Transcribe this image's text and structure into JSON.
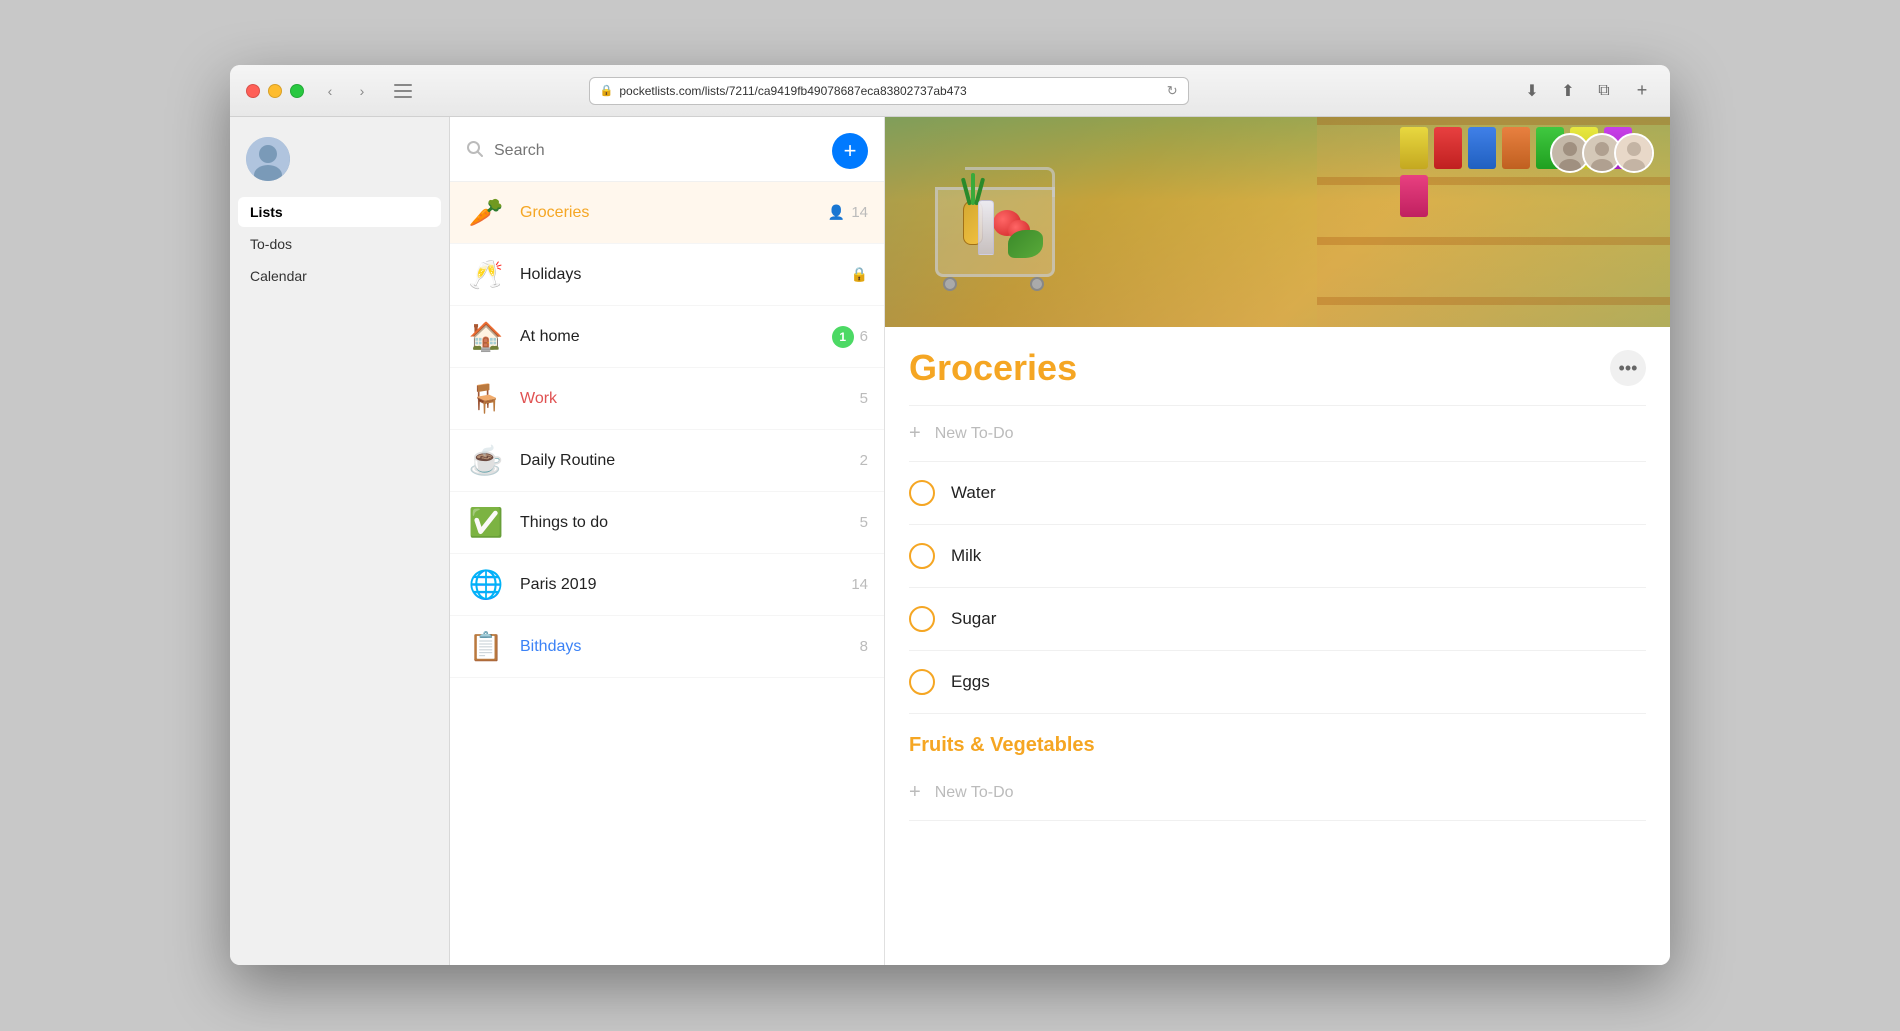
{
  "browser": {
    "url": "pocketlists.com/lists/7211/ca9419fb49078687eca83802737ab473",
    "reload_icon": "↻"
  },
  "sidebar": {
    "nav": [
      {
        "id": "lists",
        "label": "Lists",
        "active": true
      },
      {
        "id": "todos",
        "label": "To-dos",
        "active": false
      },
      {
        "id": "calendar",
        "label": "Calendar",
        "active": false
      }
    ]
  },
  "list_panel": {
    "search_placeholder": "Search",
    "add_button_label": "+",
    "items": [
      {
        "id": "groceries",
        "emoji": "🥕",
        "name": "Groceries",
        "count": "14",
        "style": "orange",
        "shared": true,
        "active": true
      },
      {
        "id": "holidays",
        "emoji": "🥂",
        "name": "Holidays",
        "count": "🔒",
        "style": "normal",
        "lock": true
      },
      {
        "id": "at-home",
        "emoji": "🏠",
        "name": "At home",
        "count": "6",
        "badge": "1",
        "style": "normal"
      },
      {
        "id": "work",
        "emoji": "🪑",
        "name": "Work",
        "count": "5",
        "style": "work-red"
      },
      {
        "id": "daily-routine",
        "emoji": "☕",
        "name": "Daily Routine",
        "count": "2",
        "style": "normal"
      },
      {
        "id": "things-to-do",
        "emoji": "✅",
        "name": "Things to do",
        "count": "5",
        "style": "normal"
      },
      {
        "id": "paris-2019",
        "emoji": "🌐",
        "name": "Paris 2019",
        "count": "14",
        "style": "normal"
      },
      {
        "id": "birthdays",
        "emoji": "📋",
        "name": "Bithdays",
        "count": "8",
        "style": "blue"
      }
    ]
  },
  "detail": {
    "title": "Groceries",
    "new_todo_label": "New To-Do",
    "more_dots": "•••",
    "todos": [
      {
        "id": "water",
        "text": "Water"
      },
      {
        "id": "milk",
        "text": "Milk"
      },
      {
        "id": "sugar",
        "text": "Sugar"
      },
      {
        "id": "eggs",
        "text": "Eggs"
      }
    ],
    "section": {
      "title": "Fruits & Vegetables",
      "new_todo_label": "New To-Do"
    }
  }
}
